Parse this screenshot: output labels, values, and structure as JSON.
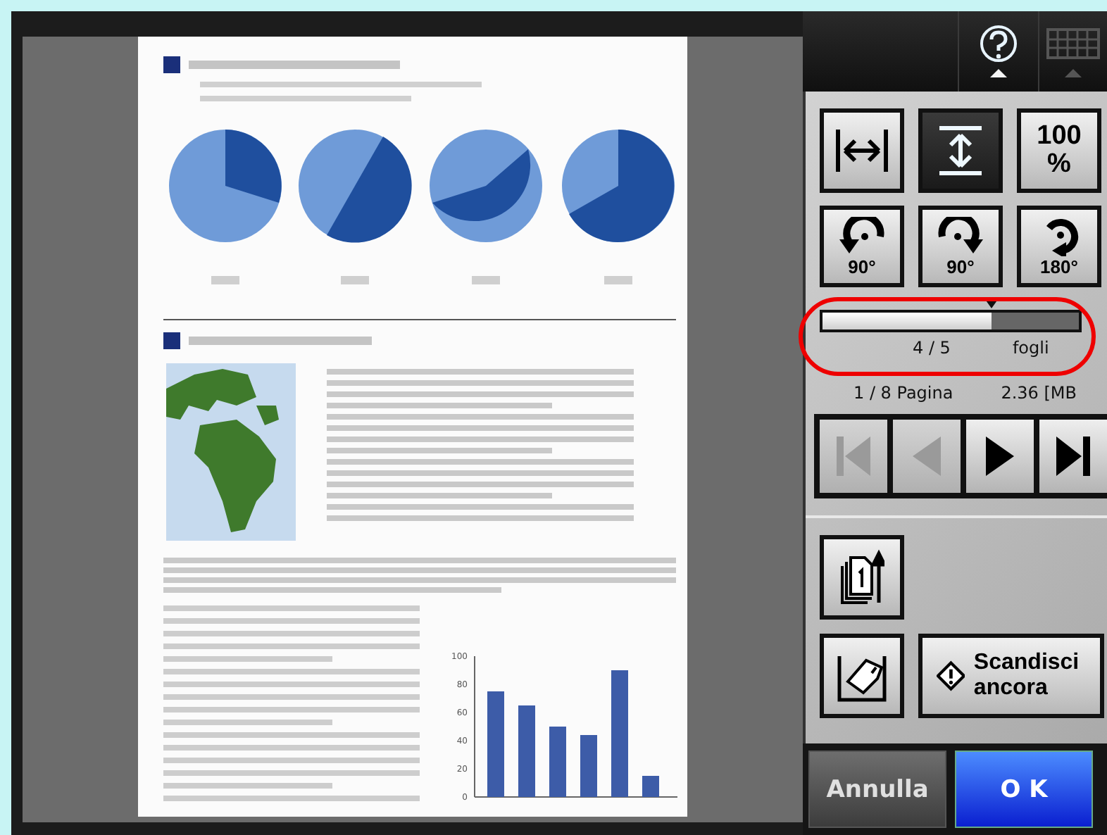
{
  "preview": {
    "chart_data": {
      "type": "bar",
      "values": [
        75,
        65,
        50,
        44,
        90,
        15
      ],
      "ylim": [
        0,
        100
      ],
      "yticks": [
        0,
        20,
        40,
        60,
        80,
        100
      ]
    }
  },
  "view_buttons": [
    {
      "kind": "fit-width",
      "selected": false
    },
    {
      "kind": "fit-height",
      "selected": true
    },
    {
      "kind": "zoom",
      "label": "100 %",
      "selected": false
    }
  ],
  "rotate_buttons": [
    {
      "kind": "left",
      "label": "90°"
    },
    {
      "kind": "right",
      "label": "90°"
    },
    {
      "kind": "half",
      "label": "180°"
    }
  ],
  "sheets": {
    "level": 0.66,
    "counter": "4 / 5",
    "unit": "fogli"
  },
  "page_info": {
    "page": "1 / 8 Pagina",
    "size": "2.36 [MB"
  },
  "nav_buttons": [
    {
      "kind": "first",
      "disabled": true
    },
    {
      "kind": "prev",
      "disabled": true
    },
    {
      "kind": "next",
      "disabled": false
    },
    {
      "kind": "last",
      "disabled": false
    }
  ],
  "rescan_button": {
    "label": "Scandisci ancora"
  },
  "footer": {
    "cancel": "Annulla",
    "ok": "O K"
  }
}
